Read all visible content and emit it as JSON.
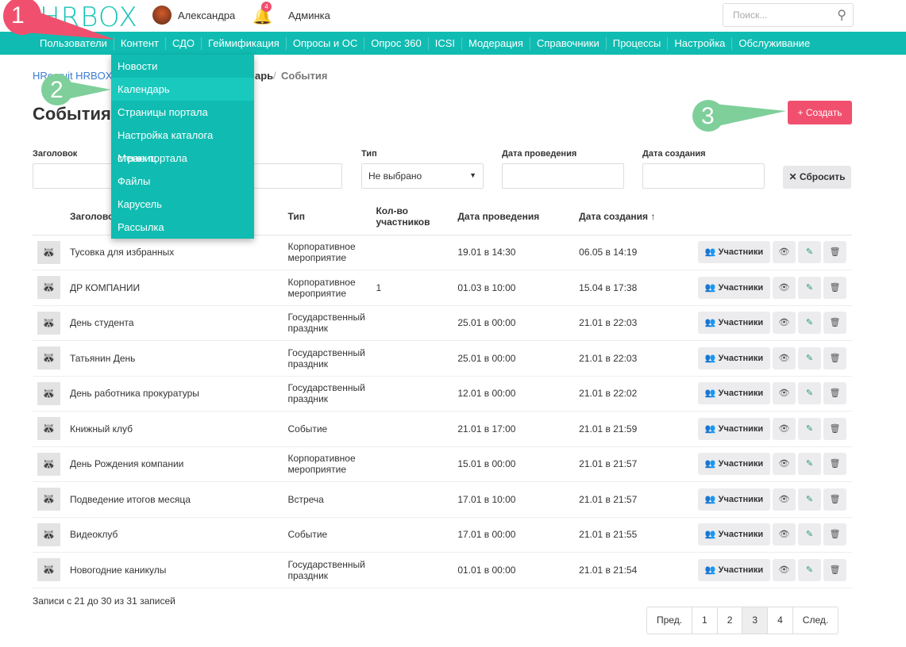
{
  "header": {
    "logo": "HRBOX",
    "user": "Александра",
    "notifications": "4",
    "admin": "Админка",
    "search_placeholder": "Поиск..."
  },
  "nav": [
    "Пользователи",
    "Контент",
    "СДО",
    "Геймификация",
    "Опросы и ОС",
    "Опрос 360",
    "ICSI",
    "Модерация",
    "Справочники",
    "Процессы",
    "Настройка",
    "Обслуживание"
  ],
  "dropdown": [
    "Новости",
    "Календарь",
    "Страницы портала",
    "Настройка каталога страниц",
    "Меню портала",
    "Файлы",
    "Карусель",
    "Рассылка"
  ],
  "breadcrumb": {
    "home": "HRecruit HRBOX",
    "mid": "арь",
    "current": "События"
  },
  "page_title": "События",
  "create_label": "+ Создать",
  "filters": {
    "title_label": "Заголовок",
    "type_label": "Тип",
    "type_value": "Не выбрано",
    "date_label": "Дата проведения",
    "created_label": "Дата создания",
    "reset_label": "✕ Сбросить"
  },
  "table": {
    "headers": [
      "Заголовок",
      "Тип",
      "Кол-во участников",
      "Дата проведения",
      "Дата создания ↑"
    ],
    "participants_label": "Участники",
    "rows": [
      [
        "Тусовка для избранных",
        "Корпоративное мероприятие",
        "",
        "19.01 в 14:30",
        "06.05 в 14:19"
      ],
      [
        "ДР КОМПАНИИ",
        "Корпоративное мероприятие",
        "1",
        "01.03 в 10:00",
        "15.04 в 17:38"
      ],
      [
        "День студента",
        "Государственный праздник",
        "",
        "25.01 в 00:00",
        "21.01 в 22:03"
      ],
      [
        "Татьянин День",
        "Государственный праздник",
        "",
        "25.01 в 00:00",
        "21.01 в 22:03"
      ],
      [
        "День работника прокуратуры",
        "Государственный праздник",
        "",
        "12.01 в 00:00",
        "21.01 в 22:02"
      ],
      [
        "Книжный клуб",
        "Событие",
        "",
        "21.01 в 17:00",
        "21.01 в 21:59"
      ],
      [
        "День Рождения компании",
        "Корпоративное мероприятие",
        "",
        "15.01 в 00:00",
        "21.01 в 21:57"
      ],
      [
        "Подведение итогов месяца",
        "Встреча",
        "",
        "17.01 в 10:00",
        "21.01 в 21:57"
      ],
      [
        "Видеоклуб",
        "Событие",
        "",
        "17.01 в 00:00",
        "21.01 в 21:55"
      ],
      [
        "Новогодние каникулы",
        "Государственный праздник",
        "",
        "01.01 в 00:00",
        "21.01 в 21:54"
      ]
    ]
  },
  "records_info": "Записи с 21 до 30 из 31 записей",
  "pagination": [
    "Пред.",
    "1",
    "2",
    "3",
    "4",
    "След."
  ],
  "pagination_active": "3",
  "annotations": [
    "1",
    "2",
    "3"
  ],
  "colors": {
    "accent": "#10bcb1",
    "create": "#f0506e",
    "arrow1": "#f0506e",
    "arrow2": "#7ecf9a"
  }
}
